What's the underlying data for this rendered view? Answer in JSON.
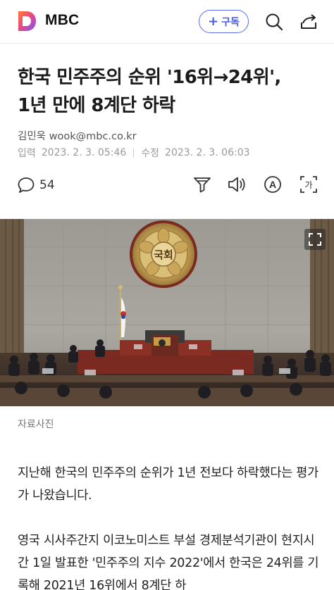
{
  "header": {
    "logo_letter": "D",
    "brand": "MBC",
    "subscribe_label": "구독",
    "subscribe_plus": "+"
  },
  "article": {
    "title_line1": "한국 민주주의 순위 '16위→24위',",
    "title_line2": "1년 만에 8계단 하락",
    "byline": "김민욱 wook@mbc.co.kr",
    "published_label": "입력",
    "published_time": "2023. 2. 3. 05:46",
    "modified_label": "수정",
    "modified_time": "2023. 2. 3. 06:03",
    "comment_count": "54",
    "photo_emblem_text": "국회",
    "photo_caption": "자료사진",
    "paragraphs": [
      "지난해 한국의 민주주의 순위가 1년 전보다 하락했다는 평가가 나왔습니다.",
      "영국 시사주간지 이코노미스트 부설 경제분석기관이 현지시간 1일 발표한 '민주주의 지수 2022'에서 한국은 24위를 기록해 2021년 16위에서 8계단 하"
    ]
  },
  "toolbar": {
    "icons": [
      "comment-icon",
      "recommend-icon",
      "listen-icon",
      "font-size-icon",
      "translate-icon"
    ],
    "font_icon_letter": "A",
    "translate_icon_letter": "가"
  },
  "colors": {
    "accent": "#5a6cf3",
    "logo_gradient_start": "#ff8a3d",
    "logo_gradient_end": "#7a4dff"
  }
}
